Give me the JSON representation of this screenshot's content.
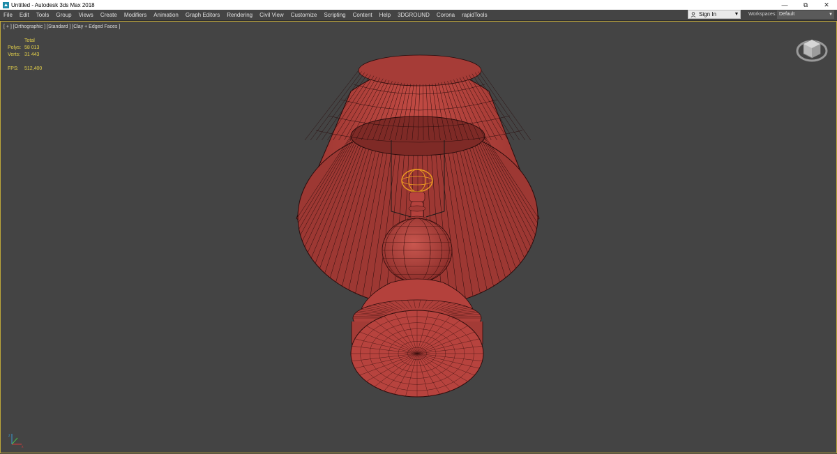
{
  "window": {
    "title": "Untitled - Autodesk 3ds Max 2018",
    "controls": [
      "minimize-icon",
      "restore-icon",
      "close-icon"
    ]
  },
  "menu": {
    "items": [
      "File",
      "Edit",
      "Tools",
      "Group",
      "Views",
      "Create",
      "Modifiers",
      "Animation",
      "Graph Editors",
      "Rendering",
      "Civil View",
      "Customize",
      "Scripting",
      "Content",
      "Help",
      "3DGROUND",
      "Corona",
      "rapidTools"
    ]
  },
  "account": {
    "sign_in_label": "Sign In"
  },
  "workspace": {
    "label": "Workspaces:",
    "value": "Default"
  },
  "viewport": {
    "label": "[ + ] [Orthographic ] [Standard ] [Clay + Edged Faces ]",
    "stats": {
      "header": "Total",
      "polys_label": "Polys:",
      "polys_value": "58 013",
      "verts_label": "Verts:",
      "verts_value": "31 443",
      "fps_label": "FPS:",
      "fps_value": "512,400"
    }
  },
  "colors": {
    "viewport_bg": "#444444",
    "model": "#b7433e",
    "wire": "#2a0c0c",
    "selection": "#f0a020",
    "stats_text": "#e6d24a"
  }
}
